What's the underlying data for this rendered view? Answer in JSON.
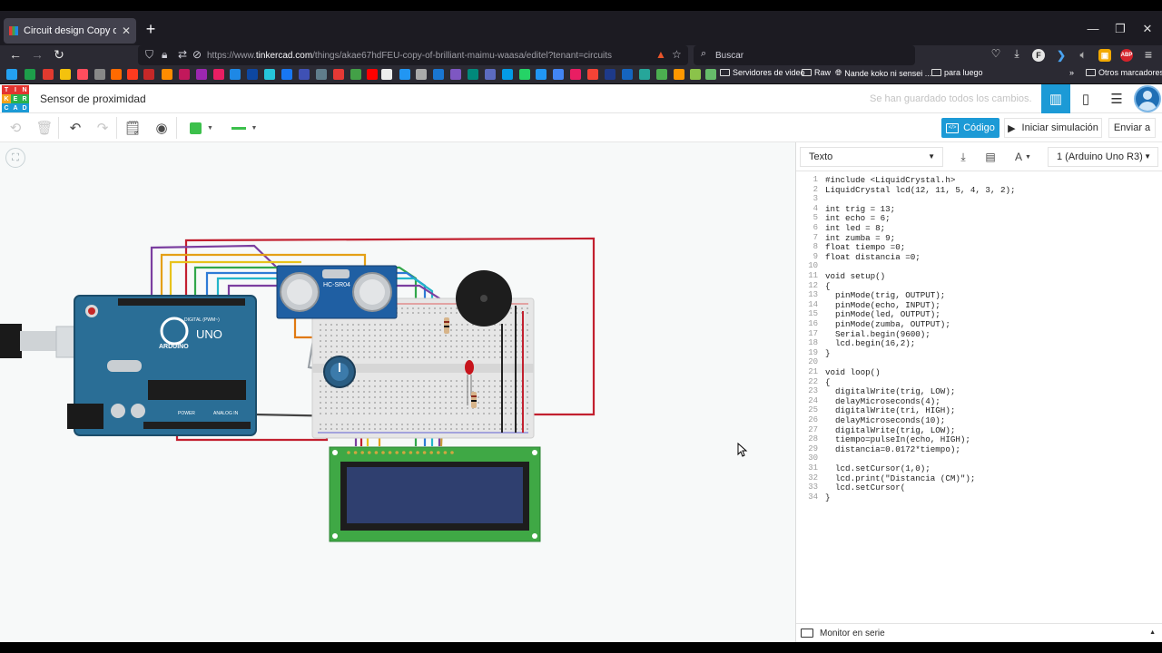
{
  "browser": {
    "tab_title": "Circuit design Copy of Brilliant",
    "url_prefix": "https://www.",
    "url_host": "tinkercad.com",
    "url_path": "/things/akae67hdFEU-copy-of-brilliant-maimu-waasa/editel?tenant=circuits",
    "search_placeholder": "Buscar",
    "bookmark_folders": [
      "Servidores de video",
      "Raw",
      "Nande koko ni sensei ...",
      "para luego"
    ],
    "other_bookmarks": "Otros marcadores"
  },
  "header": {
    "logo_letters": [
      "TIN",
      "KER",
      "CAD"
    ],
    "project_title": "Sensor de proximidad",
    "save_status": "Se han guardado todos los cambios."
  },
  "toolbar": {
    "code_button": "Código",
    "simulate_button": "Iniciar simulación",
    "send_button": "Enviar a"
  },
  "circuit": {
    "sensor_label": "HC-SR04",
    "arduino_label": "UNO",
    "arduino_brand": "ARDUINO",
    "digital_label": "DIGITAL (PWM~)",
    "power_label": "POWER",
    "analog_label": "ANALOG IN"
  },
  "code_panel": {
    "mode": "Texto",
    "board": "1 (Arduino Uno R3)",
    "serial_monitor": "Monitor en serie",
    "lines": [
      "#include <LiquidCrystal.h>",
      "LiquidCrystal lcd(12, 11, 5, 4, 3, 2);",
      "",
      "int trig = 13;",
      "int echo = 6;",
      "int led = 8;",
      "int zumba = 9;",
      "float tiempo =0;",
      "float distancia =0;",
      "",
      "void setup()",
      "{",
      "  pinMode(trig, OUTPUT);",
      "  pinMode(echo, INPUT);",
      "  pinMode(led, OUTPUT);",
      "  pinMode(zumba, OUTPUT);",
      "  Serial.begin(9600);",
      "  lcd.begin(16,2);",
      "}",
      "",
      "void loop()",
      "{",
      "  digitalWrite(trig, LOW);",
      "  delayMicroseconds(4);",
      "  digitalWrite(tri, HIGH);",
      "  delayMicroseconds(10);",
      "  digitalWrite(trig, LOW);",
      "  tiempo=pulseIn(echo, HIGH);",
      "  distancia=0.0172*tiempo);",
      "",
      "  lcd.setCursor(1,0);",
      "  lcd.print(\"Distancia (CM)\");",
      "  lcd.setCursor(",
      "}"
    ]
  },
  "colors": {
    "accent": "#1c9ad6",
    "wire_green": "#3cc04b",
    "arduino_blue": "#2a6e96",
    "lcd_green": "#3fa845"
  }
}
